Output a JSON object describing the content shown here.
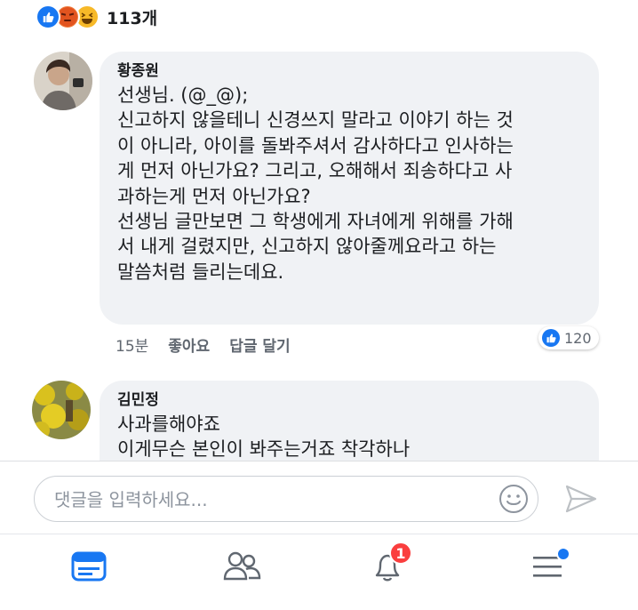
{
  "reactions": {
    "icons": [
      "like-icon",
      "angry-icon",
      "haha-icon"
    ],
    "count": "113개"
  },
  "comments": [
    {
      "author": "황종원",
      "text": "선생님. (@_@);\n신고하지 않을테니 신경쓰지 말라고 이야기 하는 것\n이 아니라, 아이를 돌봐주셔서 감사하다고 인사하는\n게 먼저 아닌가요? 그리고, 오해해서 죄송하다고 사\n과하는게 먼저 아닌가요?\n선생님 글만보면 그 학생에게 자녀에게 위해를 가해\n서 내게 걸렸지만, 신고하지 않아줄께요라고 하는\n말씀처럼 들리는데요.",
      "time": "15분",
      "like_label": "좋아요",
      "reply_label": "답글 달기",
      "like_count": "120"
    },
    {
      "author": "김민정",
      "text": "사과를해야죠\n이게무슨 본인이 봐주는거죠 착각하나"
    }
  ],
  "input": {
    "placeholder": "댓글을 입력하세요..."
  },
  "tabbar": {
    "notification_count": "1"
  },
  "colors": {
    "accent": "#1877f2",
    "bubble": "#f0f2f5",
    "badge": "#fa3e3e"
  }
}
